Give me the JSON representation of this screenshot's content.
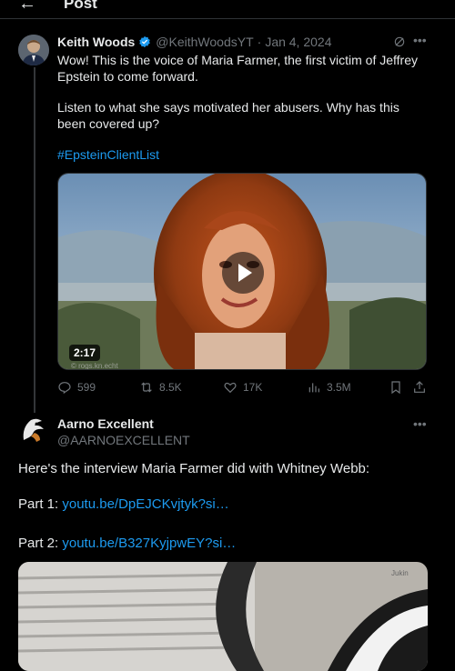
{
  "header": {
    "back_icon": "arrow-left-icon",
    "title": "Post"
  },
  "main_post": {
    "author_name": "Keith Woods",
    "verified": true,
    "handle": "@KeithWoodsYT",
    "separator": "·",
    "date": "Jan 4, 2024",
    "text_line1": "Wow! This is the voice of Maria Farmer, the first victim of Jeffrey",
    "text_line2": "Epstein to come forward.",
    "text_line3": "Listen to what she says motivated her abusers. Why has this",
    "text_line4": "been covered up?",
    "hashtag": "#EpsteinClientList",
    "media": {
      "duration": "2:17",
      "watermark": "© rogs.kn.echt"
    },
    "stats": {
      "replies": "599",
      "reposts": "8.5K",
      "likes": "17K",
      "views": "3.5M"
    }
  },
  "reply": {
    "author_name": "Aarno Excellent",
    "handle": "@AARNOEXCELLENT",
    "intro": "Here's the interview Maria Farmer did with Whitney Webb:",
    "part1_label": "Part 1:",
    "part1_link": "youtu.be/DpEJCKvjtyk?si…",
    "part2_label": "Part 2:",
    "part2_link": "youtu.be/B327KyjpwEY?si…",
    "media_watermark": "Jukin"
  },
  "colors": {
    "background": "#000000",
    "text": "#e7e9ea",
    "secondary": "#71767b",
    "accent": "#1d9bf0"
  }
}
